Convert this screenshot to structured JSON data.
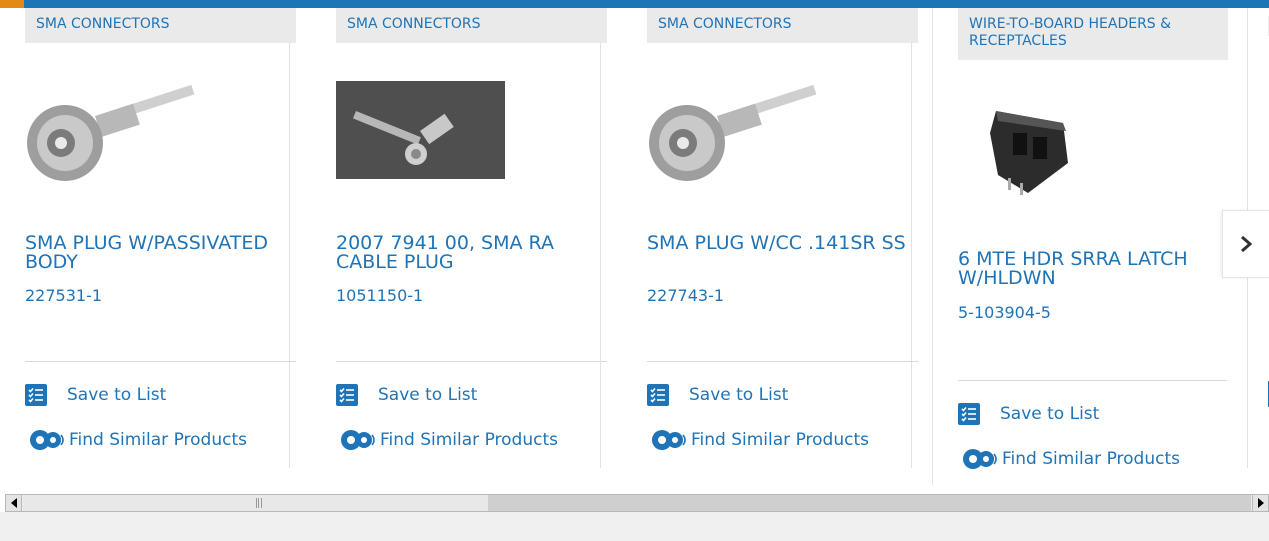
{
  "colors": {
    "accent_blue": "#1f74b7",
    "accent_orange": "#e38a14",
    "category_bg": "#eaeaea"
  },
  "cards": [
    {
      "category": "SMA CONNECTORS",
      "title": "SMA PLUG W/PASSIVATED BODY",
      "part_number": "227531-1",
      "save_label": "Save to List",
      "find_label": "Find Similar Products",
      "image": "sma-plug-photo"
    },
    {
      "category": "SMA CONNECTORS",
      "title": "2007 7941 00, SMA RA CABLE PLUG",
      "part_number": "1051150-1",
      "save_label": "Save to List",
      "find_label": "Find Similar Products",
      "image": "right-angle-cable-plug-photo"
    },
    {
      "category": "SMA CONNECTORS",
      "title": "SMA PLUG W/CC .141SR SS",
      "part_number": "227743-1",
      "save_label": "Save to List",
      "find_label": "Find Similar Products",
      "image": "sma-plug-photo"
    },
    {
      "category": "WIRE-TO-BOARD HEADERS & RECEPTACLES",
      "title": "6 MTE HDR SRRA LATCH W/HLDWN",
      "part_number": "5-103904-5",
      "save_label": "Save to List",
      "find_label": "Find Similar Products",
      "image": "header-connector-photo"
    }
  ],
  "carousel": {
    "next_icon": "chevron-right-icon"
  },
  "scrollbar": {
    "left_icon": "arrow-left-icon",
    "right_icon": "arrow-right-icon"
  }
}
